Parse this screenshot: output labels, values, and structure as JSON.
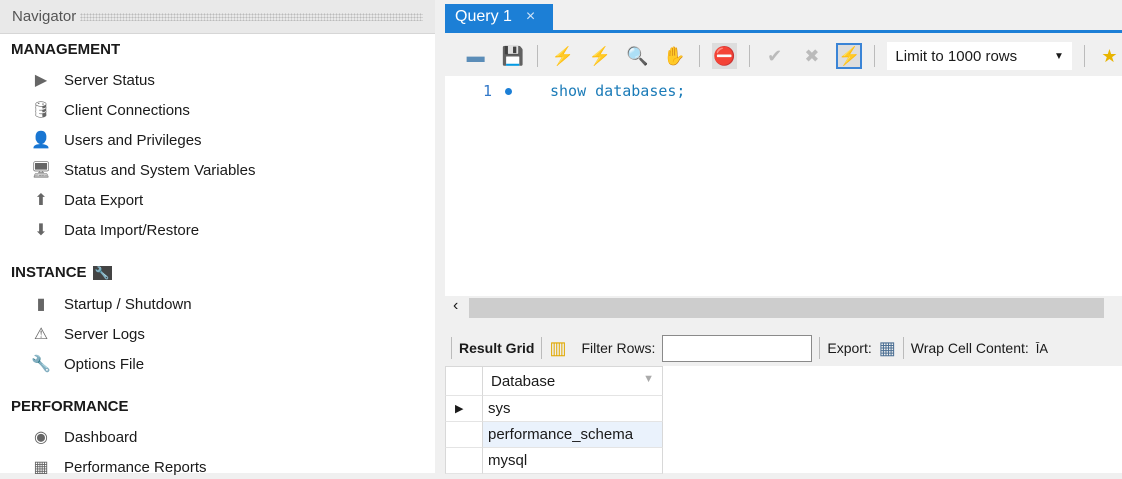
{
  "navigator": {
    "title": "Navigator",
    "sections": [
      {
        "label": "MANAGEMENT",
        "items": [
          "Server Status",
          "Client Connections",
          "Users and Privileges",
          "Status and System Variables",
          "Data Export",
          "Data Import/Restore"
        ]
      },
      {
        "label": "INSTANCE",
        "items": [
          "Startup / Shutdown",
          "Server Logs",
          "Options File"
        ]
      },
      {
        "label": "PERFORMANCE",
        "items": [
          "Dashboard",
          "Performance Reports"
        ]
      }
    ]
  },
  "tab": {
    "label": "Query 1",
    "close": "×"
  },
  "toolbar": {
    "limit": "Limit to 1000 rows"
  },
  "editor": {
    "line": "1",
    "code": "show databases;"
  },
  "results": {
    "result_grid": "Result Grid",
    "filter_label": "Filter Rows:",
    "filter_value": "",
    "export": "Export:",
    "wrap": "Wrap Cell Content:",
    "column": "Database",
    "rows": [
      "sys",
      "performance_schema",
      "mysql"
    ]
  },
  "colors": {
    "accent": "#1c7fd6"
  }
}
